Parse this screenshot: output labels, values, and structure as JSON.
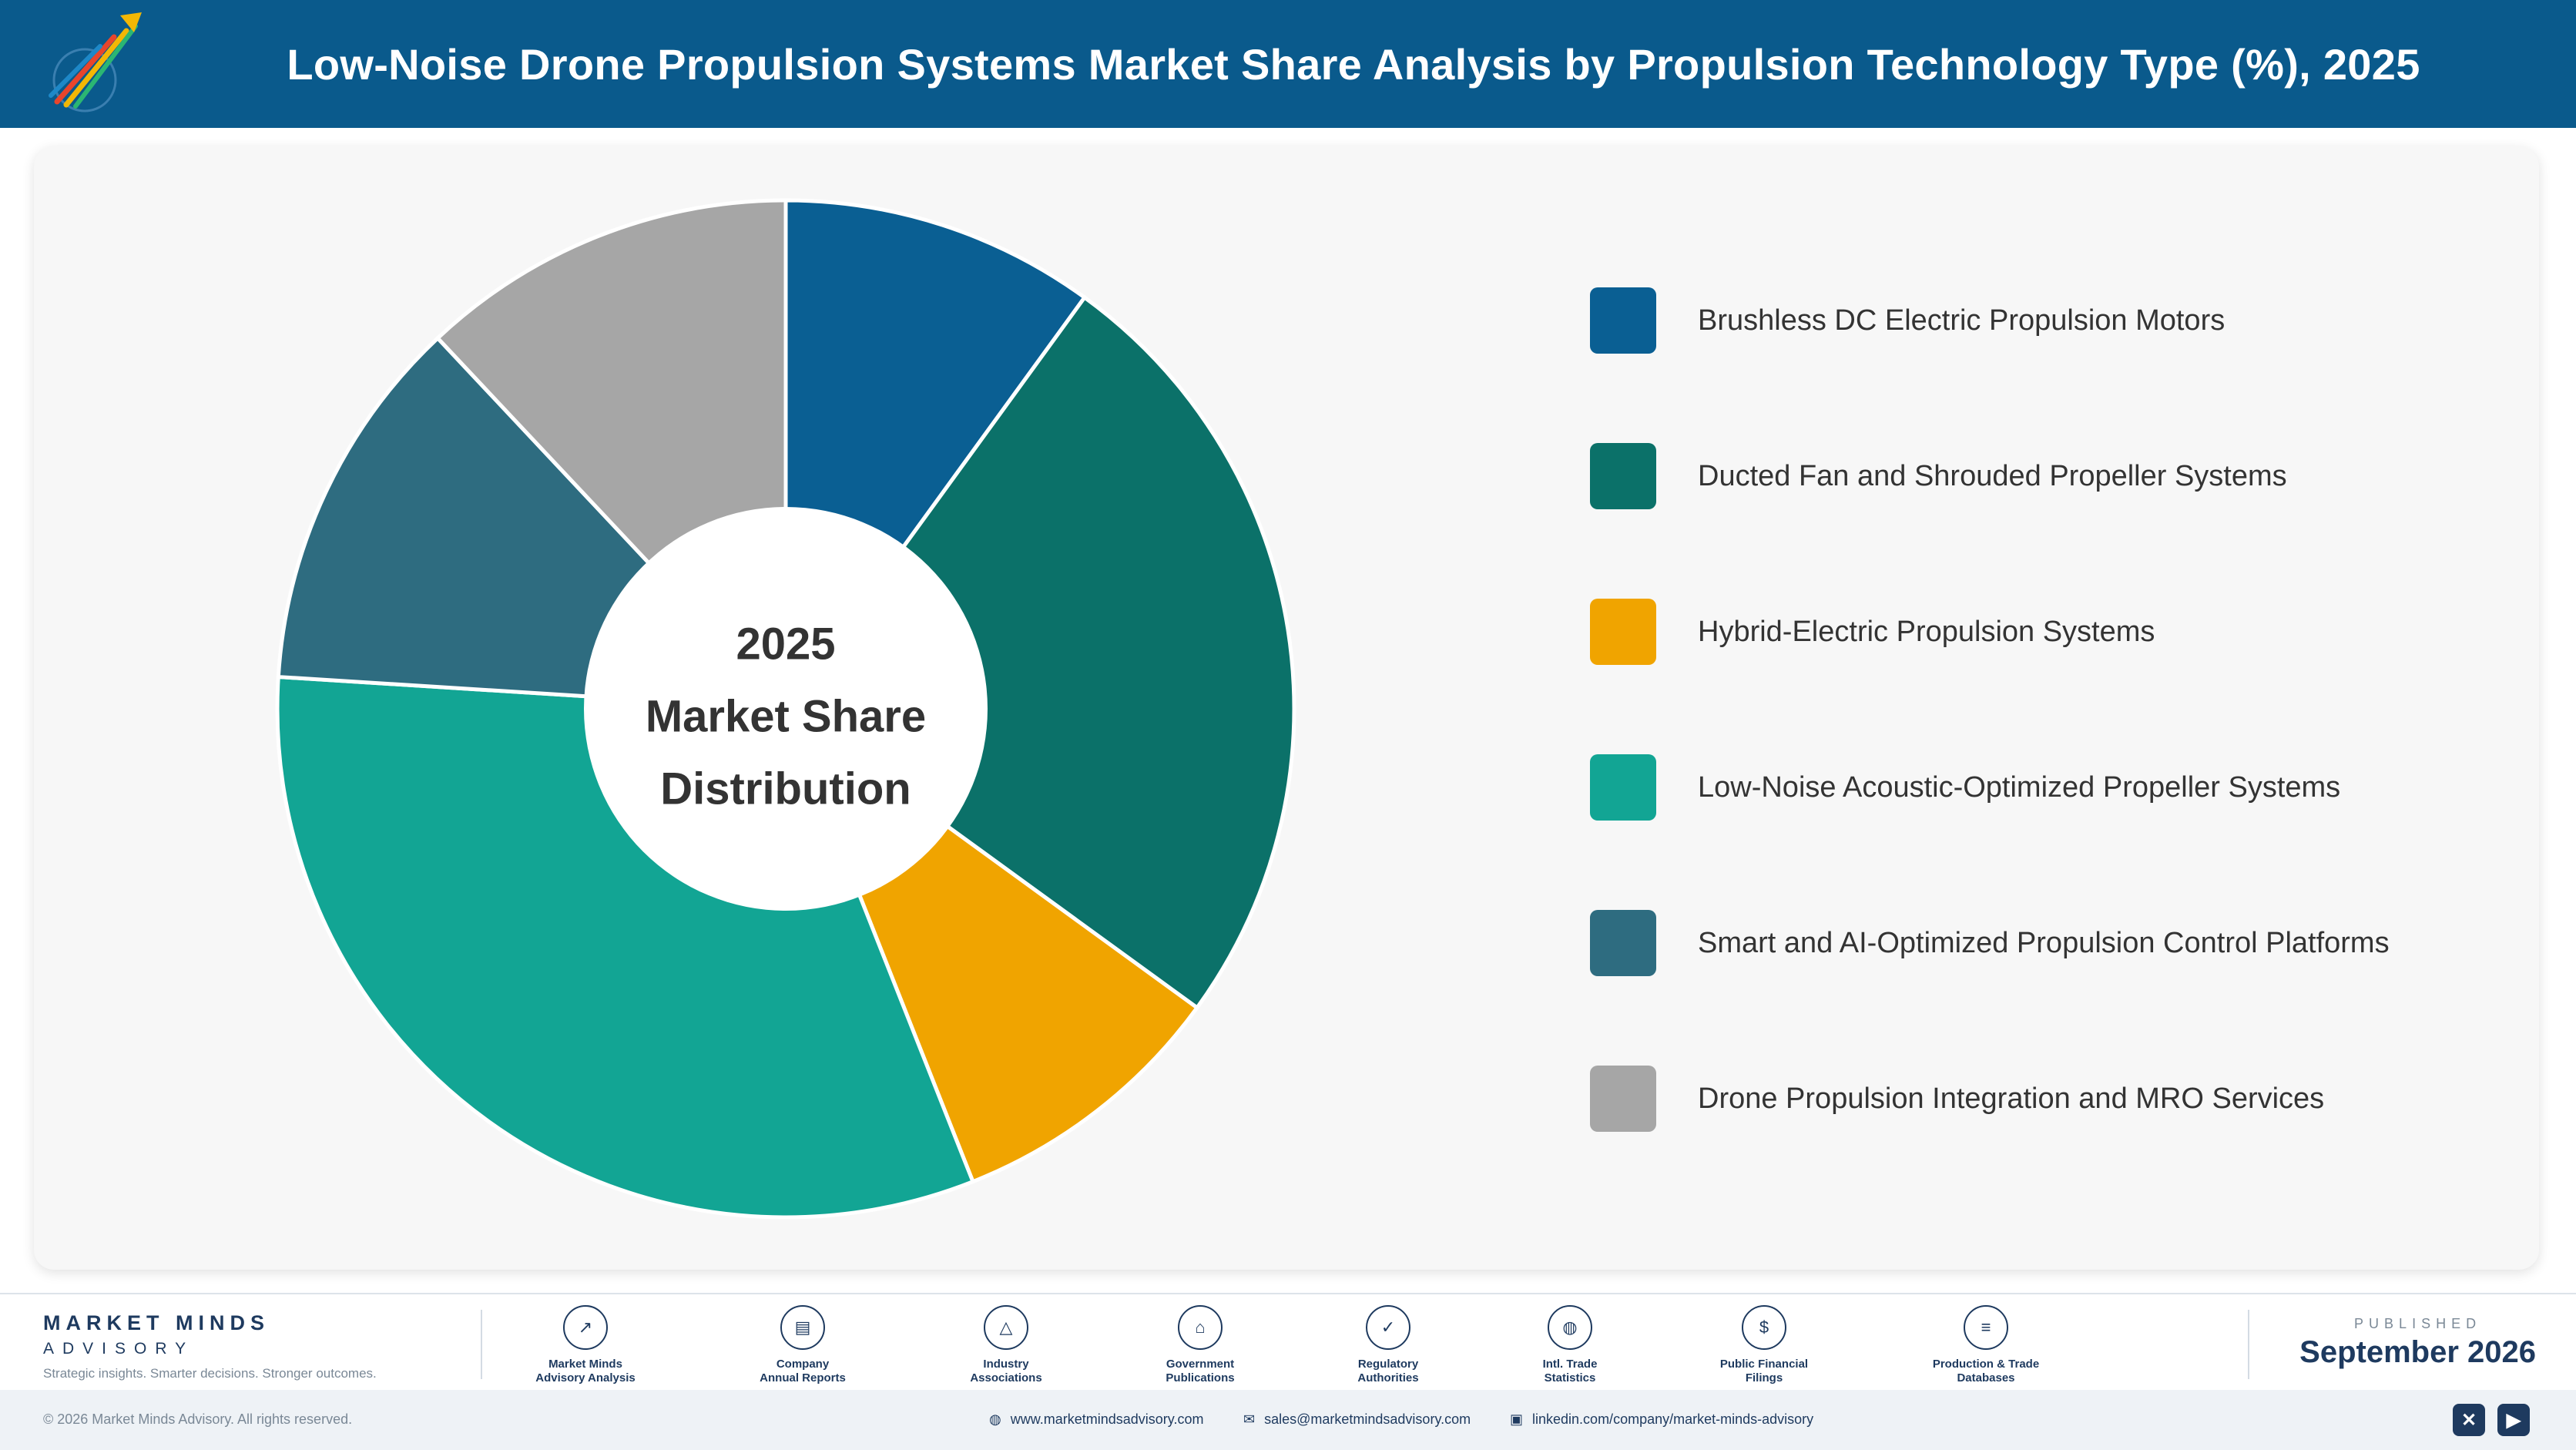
{
  "header": {
    "title": "Low-Noise Drone Propulsion Systems Market Share Analysis by Propulsion Technology Type (%), 2025"
  },
  "chart_data": {
    "type": "pie",
    "title": "Low-Noise Drone Propulsion Systems Market Share Analysis by Propulsion Technology Type (%), 2025",
    "center_text": [
      "2025",
      "Market Share",
      "Distribution"
    ],
    "categories": [
      "Brushless DC Electric Propulsion Motors",
      "Ducted Fan and Shrouded Propeller Systems",
      "Hybrid-Electric Propulsion Systems",
      "Low-Noise Acoustic-Optimized Propeller Systems",
      "Smart and AI-Optimized Propulsion Control Platforms",
      "Drone Propulsion Integration and MRO Services"
    ],
    "values": [
      10,
      25,
      9,
      32,
      12,
      12
    ],
    "colors": [
      "#0a5f93",
      "#0b7169",
      "#f0a400",
      "#12a594",
      "#2e6c80",
      "#a6a6a6"
    ],
    "legend": "right"
  },
  "footer": {
    "brand_name": "MARKET MINDS",
    "brand_sub": "ADVISORY",
    "tagline": "Strategic insights. Smarter decisions. Stronger outcomes.",
    "sources": [
      {
        "icon": "trend-chart-icon",
        "line1": "Market Minds",
        "line2": "Advisory Analysis"
      },
      {
        "icon": "document-icon",
        "line1": "Company",
        "line2": "Annual Reports"
      },
      {
        "icon": "network-icon",
        "line1": "Industry",
        "line2": "Associations"
      },
      {
        "icon": "government-building-icon",
        "line1": "Government",
        "line2": "Publications"
      },
      {
        "icon": "shield-check-icon",
        "line1": "Regulatory",
        "line2": "Authorities"
      },
      {
        "icon": "globe-icon",
        "line1": "Intl. Trade",
        "line2": "Statistics"
      },
      {
        "icon": "dollar-coin-icon",
        "line1": "Public Financial",
        "line2": "Filings"
      },
      {
        "icon": "database-icon",
        "line1": "Production & Trade",
        "line2": "Databases"
      }
    ],
    "published_label": "PUBLISHED",
    "published_date": "September 2026"
  },
  "bottom_bar": {
    "copyright": "© 2026 Market Minds Advisory. All rights reserved.",
    "website": "www.marketmindsadvisory.com",
    "email": "sales@marketmindsadvisory.com",
    "linkedin": "linkedin.com/company/market-minds-advisory"
  }
}
